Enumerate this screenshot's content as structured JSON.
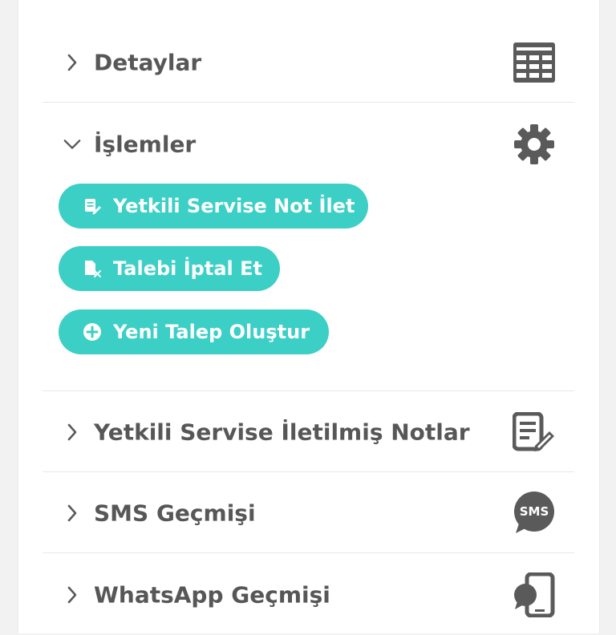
{
  "sections": {
    "detaylar": {
      "label": "Detaylar",
      "icon": "table-icon"
    },
    "islemler": {
      "label": "İşlemler",
      "icon": "gear-icon"
    },
    "notlar": {
      "label": "Yetkili Servise İletilmiş Notlar",
      "icon": "note-edit-icon"
    },
    "sms": {
      "label": "SMS Geçmişi",
      "icon": "sms-icon",
      "badge": "SMS"
    },
    "whatsapp": {
      "label": "WhatsApp Geçmişi",
      "icon": "phone-chat-icon"
    }
  },
  "actions": [
    {
      "label": "Yetkili Servise Not İlet",
      "icon": "note-edit-icon"
    },
    {
      "label": "Talebi İptal Et",
      "icon": "file-cancel-icon"
    },
    {
      "label": "Yeni Talep Oluştur",
      "icon": "plus-circle-icon"
    }
  ],
  "colors": {
    "accent": "#3ccfc6",
    "text": "#575757",
    "icon": "#5a5a5a",
    "divider": "#e8e8e8"
  }
}
